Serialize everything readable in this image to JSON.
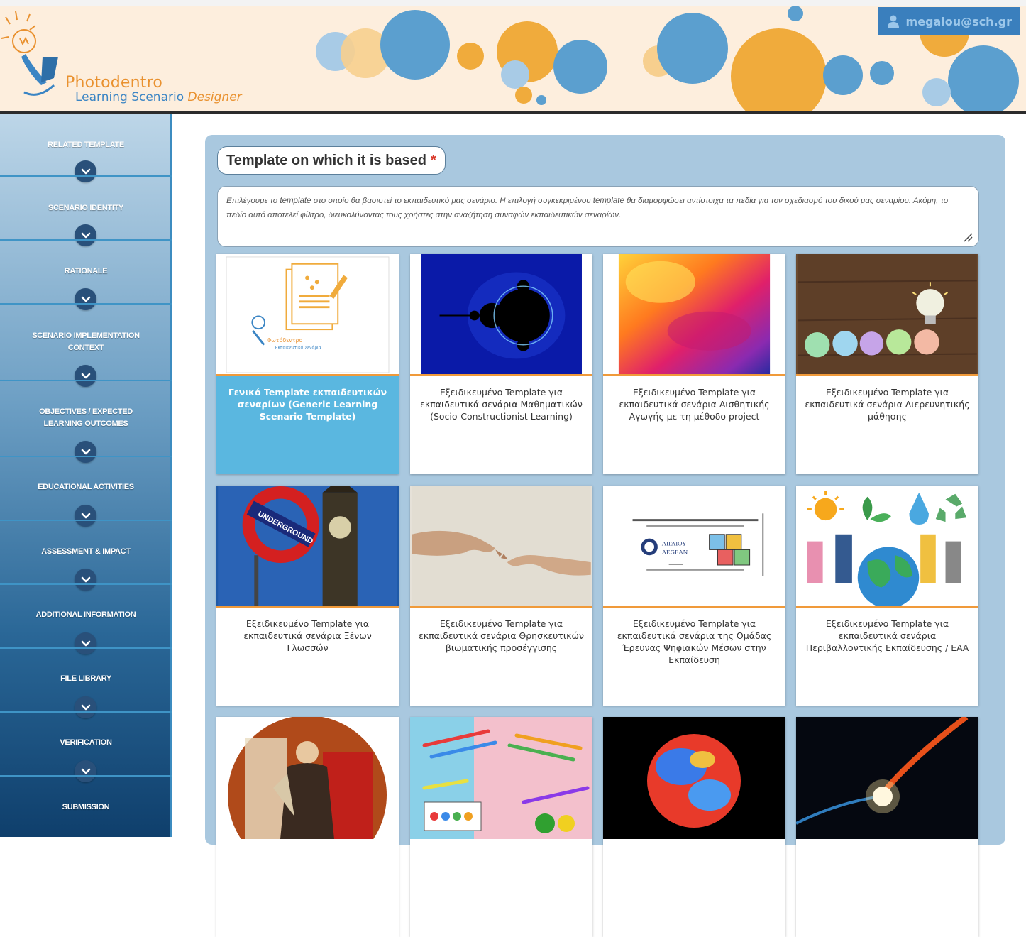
{
  "header": {
    "logo_line1": "Photodentro",
    "logo_line2": "Learning Scenario",
    "logo_line2_accent": "Designer",
    "user_email": "megalou@sch.gr"
  },
  "sidebar": {
    "items": [
      "RELATED TEMPLATE",
      "SCENARIO IDENTITY",
      "RATIONALE",
      "SCENARIO IMPLEMENTATION CONTEXT",
      "OBJECTIVES / EXPECTED LEARNING OUTCOMES",
      "EDUCATIONAL ACTIVITIES",
      "ASSESSMENT & IMPACT",
      "ADDITIONAL INFORMATION",
      "FILE LIBRARY",
      "VERIFICATION",
      "SUBMISSION"
    ]
  },
  "main": {
    "field_label": "Template on which it is based",
    "required_mark": "*",
    "help_text": "Επιλέγουμε το template στο οποίο θα βασιστεί το εκπαιδευτικό μας σενάριο. Η επιλογή συγκεκριμένου template θα διαμορφώσει αντίστοιχα τα πεδία για τον σχεδιασμό του δικού μας σεναρίου. Ακόμη, το πεδίο αυτό αποτελεί φίλτρο, διευκολύνοντας τους χρήστες στην αναζήτηση συναφών εκπαιδευτικών σεναρίων.",
    "selected_index": 0,
    "templates": [
      "Γενικό Template εκπαιδευτικών σεναρίων (Generic Learning Scenario Template)",
      "Εξειδικευμένο Template για εκπαιδευτικά σενάρια Μαθηματικών (Socio-Constructionist Learning)",
      "Εξειδικευμένο Template για εκπαιδευτικά σενάρια Αισθητικής Αγωγής με τη μέθοδο project",
      "Εξειδικευμένο Template για εκπαιδευτικά σενάρια Διερευνητικής μάθησης",
      "Εξειδικευμένο Template για εκπαιδευτικά σενάρια Ξένων Γλωσσών",
      "Εξειδικευμένο Template για εκπαιδευτικά σενάρια Θρησκευτικών βιωματικής προσέγγισης",
      "Εξειδικευμένο Template για εκπαιδευτικά σενάρια της Ομάδας Έρευνας Ψηφιακών Μέσων στην Εκπαίδευση",
      "Εξειδικευμένο Template για εκπαιδευτικά σενάρια Περιβαλλοντικής Εκπαίδευσης / ΕΑΑ"
    ],
    "thumb_texts": {
      "underground_sign": "UNDERGROUND",
      "aegean_gr": "ΑΙΓΑΙΟΥ",
      "aegean_en": "AEGEAN"
    }
  },
  "colors": {
    "accent_blue": "#3a7fbd",
    "selected_card": "#5ab7e0",
    "thumb_border": "#f09a3a",
    "required": "#d93a2b"
  },
  "icons": [
    "lightbulb-logo-icon",
    "user-icon",
    "chevron-down-icon",
    "resize-handle-icon"
  ]
}
